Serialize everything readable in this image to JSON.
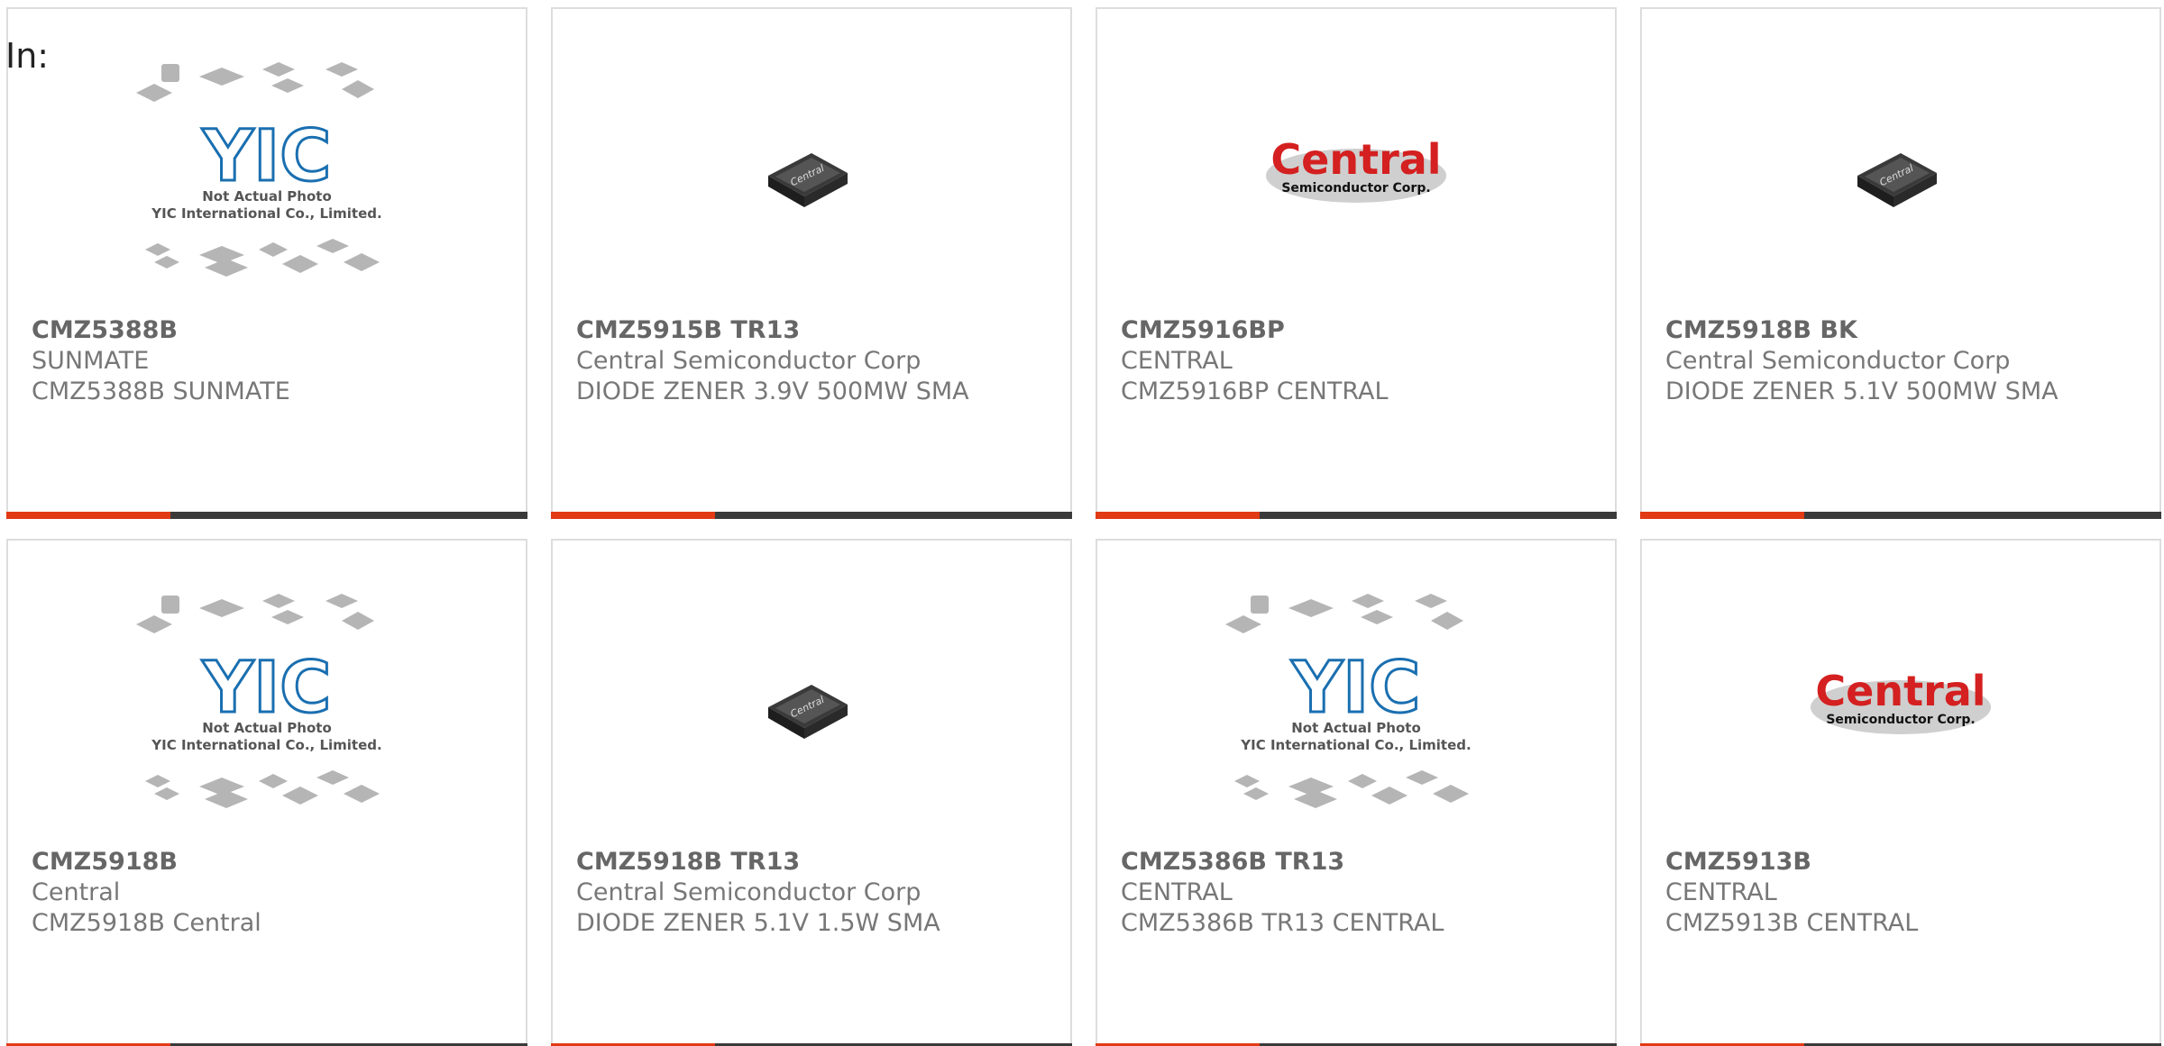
{
  "heading": "In:",
  "colors": {
    "accent": "#e13a14",
    "bar_dark": "#3a3a3a",
    "yic_blue": "#1a6fb0",
    "central_red": "#d42020"
  },
  "products": [
    {
      "part": "CMZ5388B",
      "manufacturer": "SUNMATE",
      "description": "CMZ5388B SUNMATE",
      "image": "yic-placeholder",
      "placeholder_line1": "Not Actual Photo",
      "placeholder_line2": "YIC International Co., Limited.",
      "logo_text": "YIC"
    },
    {
      "part": "CMZ5915B TR13",
      "manufacturer": "Central Semiconductor Corp",
      "description": "DIODE ZENER 3.9V 500MW SMA",
      "image": "sma-package",
      "chip_text": "Central"
    },
    {
      "part": "CMZ5916BP",
      "manufacturer": "CENTRAL",
      "description": "CMZ5916BP CENTRAL",
      "image": "central-logo",
      "logo_main": "Central",
      "logo_sub": "Semiconductor Corp."
    },
    {
      "part": "CMZ5918B BK",
      "manufacturer": "Central Semiconductor Corp",
      "description": "DIODE ZENER 5.1V 500MW SMA",
      "image": "sma-package",
      "chip_text": "Central"
    },
    {
      "part": "CMZ5918B",
      "manufacturer": "Central",
      "description": "CMZ5918B Central",
      "image": "yic-placeholder",
      "placeholder_line1": "Not Actual Photo",
      "placeholder_line2": "YIC International Co., Limited.",
      "logo_text": "YIC"
    },
    {
      "part": "CMZ5918B TR13",
      "manufacturer": "Central Semiconductor Corp",
      "description": "DIODE ZENER 5.1V 1.5W SMA",
      "image": "sma-package",
      "chip_text": "Central"
    },
    {
      "part": "CMZ5386B TR13",
      "manufacturer": "CENTRAL",
      "description": "CMZ5386B TR13 CENTRAL",
      "image": "yic-placeholder",
      "placeholder_line1": "Not Actual Photo",
      "placeholder_line2": "YIC International Co., Limited.",
      "logo_text": "YIC"
    },
    {
      "part": "CMZ5913B",
      "manufacturer": "CENTRAL",
      "description": "CMZ5913B CENTRAL",
      "image": "central-logo",
      "logo_main": "Central",
      "logo_sub": "Semiconductor Corp."
    }
  ]
}
